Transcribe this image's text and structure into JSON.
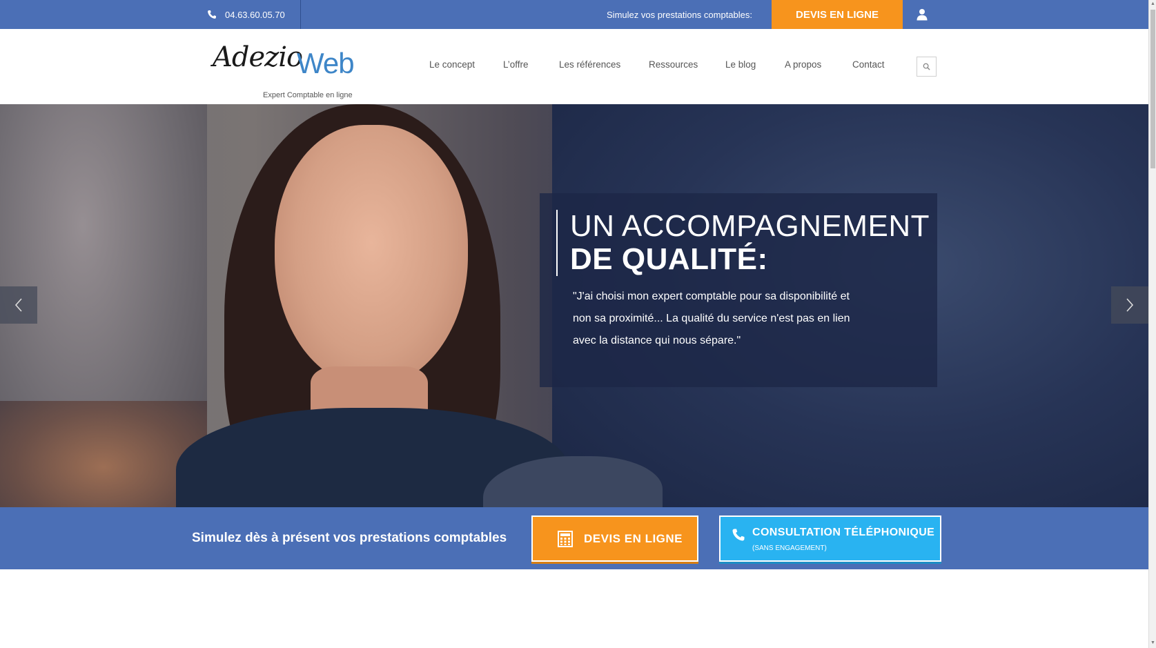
{
  "topbar": {
    "phone": "04.63.60.05.70",
    "simulate_text": "Simulez vos prestations comptables:",
    "devis_label": "DEVIS EN LIGNE",
    "accent_color": "#f7941d",
    "bar_color": "#4b6fb6"
  },
  "header": {
    "logo": {
      "brand_script": "Adezio",
      "brand_web": "Web",
      "tagline": "Expert Comptable en ligne"
    },
    "nav": [
      {
        "label": "Le concept"
      },
      {
        "label": "L’offre"
      },
      {
        "label": "Les références"
      },
      {
        "label": "Ressources"
      },
      {
        "label": "Le blog"
      },
      {
        "label": "A propos"
      },
      {
        "label": "Contact"
      }
    ]
  },
  "hero": {
    "title_line1": "UN ACCOMPAGNEMENT",
    "title_line2": "DE QUALITÉ:",
    "quote": "\"J'ai choisi mon expert comptable pour sa disponibilité et non sa proximité... La qualité du service n'est pas en lien avec la distance qui nous sépare.\""
  },
  "cta": {
    "text": "Simulez dès à présent vos prestations comptables",
    "devis_label": "DEVIS EN LIGNE",
    "consult_label": "CONSULTATION TÉLÉPHONIQUE",
    "consult_sub": "(SANS ENGAGEMENT)",
    "consult_color": "#29b3f1"
  }
}
